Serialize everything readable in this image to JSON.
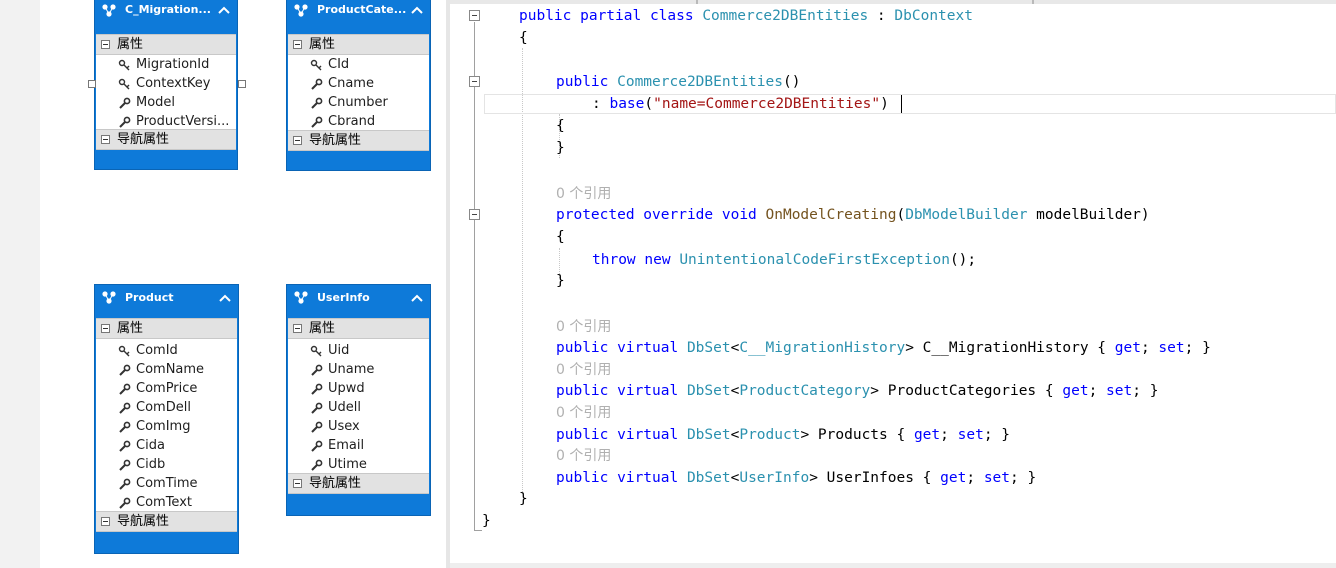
{
  "entities": [
    {
      "name": "C_Migration...",
      "properties_label": "属性",
      "nav_label": "导航属性",
      "properties": [
        {
          "name": "MigrationId",
          "icon": "key-icon"
        },
        {
          "name": "ContextKey",
          "icon": "key-icon"
        },
        {
          "name": "Model",
          "icon": "property-wrench-icon"
        },
        {
          "name": "ProductVersi...",
          "icon": "property-wrench-icon"
        }
      ]
    },
    {
      "name": "ProductCate...",
      "properties_label": "属性",
      "nav_label": "导航属性",
      "properties": [
        {
          "name": "CId",
          "icon": "key-icon"
        },
        {
          "name": "Cname",
          "icon": "property-wrench-icon"
        },
        {
          "name": "Cnumber",
          "icon": "property-wrench-icon"
        },
        {
          "name": "Cbrand",
          "icon": "property-wrench-icon"
        }
      ]
    },
    {
      "name": "Product",
      "properties_label": "属性",
      "nav_label": "导航属性",
      "properties": [
        {
          "name": "ComId",
          "icon": "key-icon"
        },
        {
          "name": "ComName",
          "icon": "property-wrench-icon"
        },
        {
          "name": "ComPrice",
          "icon": "property-wrench-icon"
        },
        {
          "name": "ComDell",
          "icon": "property-wrench-icon"
        },
        {
          "name": "ComImg",
          "icon": "property-wrench-icon"
        },
        {
          "name": "Cida",
          "icon": "property-wrench-icon"
        },
        {
          "name": "Cidb",
          "icon": "property-wrench-icon"
        },
        {
          "name": "ComTime",
          "icon": "property-wrench-icon"
        },
        {
          "name": "ComText",
          "icon": "property-wrench-icon"
        }
      ]
    },
    {
      "name": "UserInfo",
      "properties_label": "属性",
      "nav_label": "导航属性",
      "properties": [
        {
          "name": "Uid",
          "icon": "key-icon"
        },
        {
          "name": "Uname",
          "icon": "property-wrench-icon"
        },
        {
          "name": "Upwd",
          "icon": "property-wrench-icon"
        },
        {
          "name": "Udell",
          "icon": "property-wrench-icon"
        },
        {
          "name": "Usex",
          "icon": "property-wrench-icon"
        },
        {
          "name": "Email",
          "icon": "property-wrench-icon"
        },
        {
          "name": "Utime",
          "icon": "property-wrench-icon"
        }
      ]
    }
  ],
  "code": {
    "ref_hint": "0 个引用",
    "class_decl": {
      "mods": "public partial class ",
      "name": "Commerce2DBEntities",
      "sep": " : ",
      "base": "DbContext"
    },
    "ctor": {
      "mods": "public ",
      "name": "Commerce2DBEntities",
      "parens": "()"
    },
    "base_call": {
      "prefix": ": ",
      "kw": "base",
      "open": "(",
      "str": "\"name=Commerce2DBEntities\"",
      "close": ")"
    },
    "method": {
      "mods": "protected override void ",
      "name": "OnModelCreating",
      "open": "(",
      "ptype": "DbModelBuilder",
      "pname": " modelBuilder)"
    },
    "throw_stmt": {
      "kw1": "throw",
      "kw2": " new ",
      "type": "UnintentionalCodeFirstException",
      "end": "();"
    },
    "props": [
      {
        "mods": "public virtual ",
        "type": "DbSet",
        "lt": "<",
        "arg": "C__MigrationHistory",
        "gt": ">",
        "name": " C__MigrationHistory { ",
        "get": "get",
        "semi1": "; ",
        "set": "set",
        "semi2": "; }"
      },
      {
        "mods": "public virtual ",
        "type": "DbSet",
        "lt": "<",
        "arg": "ProductCategory",
        "gt": ">",
        "name": " ProductCategories { ",
        "get": "get",
        "semi1": "; ",
        "set": "set",
        "semi2": "; }"
      },
      {
        "mods": "public virtual ",
        "type": "DbSet",
        "lt": "<",
        "arg": "Product",
        "gt": ">",
        "name": " Products { ",
        "get": "get",
        "semi1": "; ",
        "set": "set",
        "semi2": "; }"
      },
      {
        "mods": "public virtual ",
        "type": "DbSet",
        "lt": "<",
        "arg": "UserInfo",
        "gt": ">",
        "name": " UserInfoes { ",
        "get": "get",
        "semi1": "; ",
        "set": "set",
        "semi2": "; }"
      }
    ],
    "brace_open": "{",
    "brace_close": "}"
  },
  "colors": {
    "entity_blue": "#0e7ad9",
    "keyword": "#0000ff",
    "type": "#2b91af",
    "string": "#a31515",
    "ref_hint": "#b0b0b0"
  }
}
